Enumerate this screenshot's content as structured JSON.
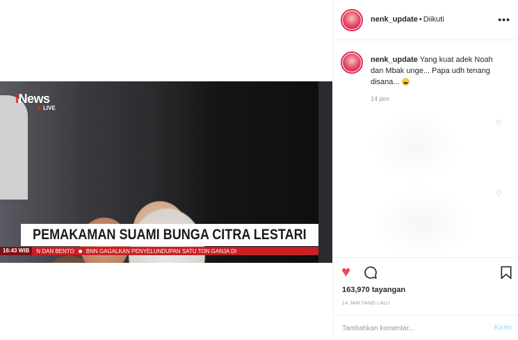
{
  "post": {
    "username": "nenk_update",
    "follow_status": "Diikuti",
    "more_icon": "more-horizontal-icon",
    "caption_text": "Yang kuat adek Noah dan Mbak unge... Papa udh tenang disana...",
    "caption_emoji": "crying-face-emoji",
    "caption_time": "14 jam",
    "views": "163,970 tayangan",
    "posted_ago": "14 JAM YANG LALU",
    "comment_placeholder": "Tambahkan komentar...",
    "post_button": "Kirim",
    "accent_like_color": "#ed4956"
  },
  "video": {
    "channel_brand_i": "i",
    "channel_brand_rest": "News",
    "live_label": "LIVE",
    "headline": "PEMAKAMAN SUAMI BUNGA CITRA LESTARI",
    "ticker_time": "16:43 WIB",
    "ticker_items": [
      "N DAN BENTO",
      "BNN GAGALKAN PENYELUNDUPAN SATU TON GANJA DI"
    ]
  }
}
